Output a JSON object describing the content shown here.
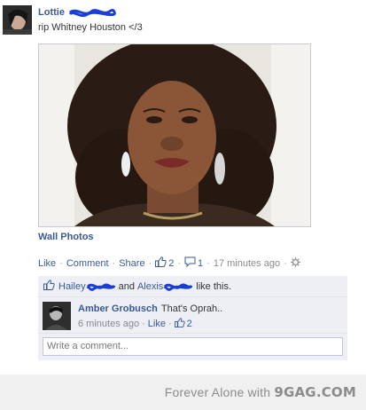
{
  "post": {
    "author": "Lottie",
    "status_text": "rip Whitney Houston </3",
    "album_link": "Wall Photos"
  },
  "actions": {
    "like": "Like",
    "comment": "Comment",
    "share": "Share",
    "like_count": "2",
    "comment_count": "1",
    "timestamp": "17 minutes ago"
  },
  "likes_row": {
    "name1": "Hailey",
    "joiner": "and",
    "name2": "Alexis",
    "suffix": "like this."
  },
  "comment": {
    "author": "Amber Grobusch",
    "text": "That's Oprah..",
    "timestamp": "6 minutes ago",
    "like": "Like",
    "like_count": "2"
  },
  "write_comment": {
    "placeholder": "Write a comment..."
  },
  "watermark": {
    "prefix": "Forever Alone with",
    "brand": "9GAG.COM"
  },
  "colors": {
    "link": "#3b5998",
    "meta": "#8a8a8a",
    "ufi_bg": "#edeff4",
    "scribble": "#1a3fd6"
  }
}
